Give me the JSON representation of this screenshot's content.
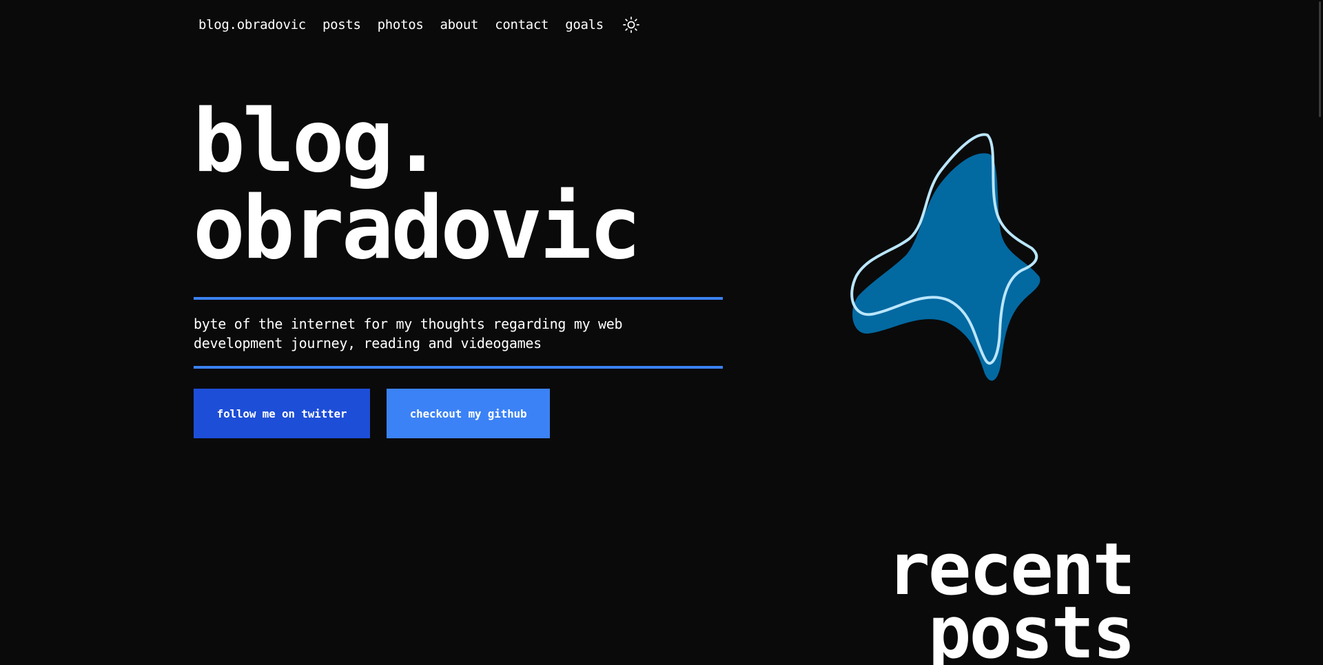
{
  "nav": {
    "brand": "blog.obradovic",
    "items": [
      {
        "label": "posts"
      },
      {
        "label": "photos"
      },
      {
        "label": "about"
      },
      {
        "label": "contact"
      },
      {
        "label": "goals"
      }
    ],
    "theme_icon": "sun-icon"
  },
  "hero": {
    "title_line1": "blog.",
    "title_line2": "obradovic",
    "tagline": "byte of the internet for my thoughts regarding my web development journey, reading and videogames",
    "buttons": {
      "twitter": "follow me on twitter",
      "github": "checkout my github"
    },
    "illustration": "abstract-blob-icon"
  },
  "recent": {
    "title_line1": "recent",
    "title_line2": "posts"
  },
  "colors": {
    "background": "#0a0a0a",
    "accent": "#3b82f6",
    "button_primary": "#1d4ed8",
    "button_secondary": "#3b82f6",
    "blob_fill": "#0369a1",
    "blob_outline": "#bae6fd"
  }
}
